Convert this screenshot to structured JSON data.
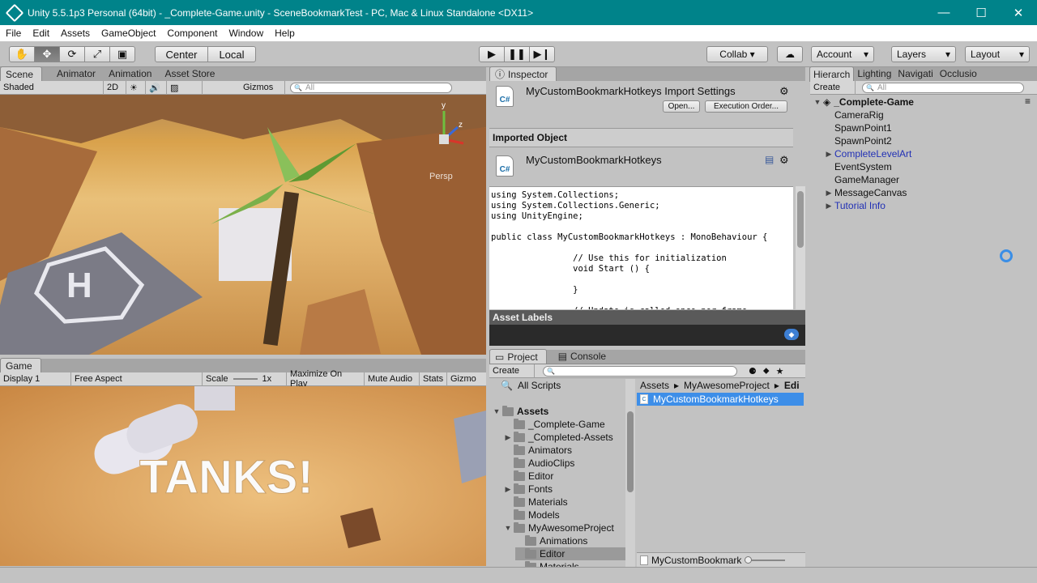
{
  "window": {
    "title": "Unity 5.5.1p3 Personal (64bit) - _Complete-Game.unity - SceneBookmarkTest - PC, Mac & Linux Standalone <DX11>",
    "controls": [
      "—",
      "☐",
      "✕"
    ]
  },
  "menu": [
    "File",
    "Edit",
    "Assets",
    "GameObject",
    "Component",
    "Window",
    "Help"
  ],
  "toolbar": {
    "transform_tools": [
      "hand-tool",
      "move-tool",
      "rotate-tool",
      "scale-tool",
      "rect-tool"
    ],
    "pivot_label": "Center",
    "space_label": "Local",
    "collab_label": "Collab ▾",
    "account_label": "Account",
    "layers_label": "Layers",
    "layout_label": "Layout"
  },
  "scene_panel": {
    "tabs": [
      "Scene",
      "Animator",
      "Animation",
      "Asset Store"
    ],
    "shading": "Shaded",
    "mode_2d": "2D",
    "gizmos": "Gizmos",
    "search_placeholder": "All",
    "persp_label": "Persp"
  },
  "game_panel": {
    "tab": "Game",
    "display": "Display 1",
    "aspect": "Free Aspect",
    "scale_label": "Scale",
    "scale_value": "1x",
    "maximize": "Maximize On Play",
    "mute": "Mute Audio",
    "stats": "Stats",
    "gizmos": "Gizmo",
    "logo_text": "TANKS!"
  },
  "inspector": {
    "tab": "Inspector",
    "header_title": "MyCustomBookmarkHotkeys Import Settings",
    "open_button": "Open...",
    "execution_order_button": "Execution Order...",
    "imported_object_heading": "Imported Object",
    "object_name": "MyCustomBookmarkHotkeys",
    "icon_text": "C#",
    "code": "using System.Collections;\nusing System.Collections.Generic;\nusing UnityEngine;\n\npublic class MyCustomBookmarkHotkeys : MonoBehaviour {\n\n\t\t// Use this for initialization\n\t\tvoid Start () {\n\n\t\t}\n\n\t\t// Update is called once per frame",
    "asset_labels_heading": "Asset Labels"
  },
  "project": {
    "tabs": [
      "Project",
      "Console"
    ],
    "create_label": "Create",
    "favorites": [
      "All Scripts"
    ],
    "tree": [
      {
        "label": "Assets",
        "depth": 0,
        "arrow": "▼",
        "bold": true
      },
      {
        "label": "_Complete-Game",
        "depth": 1,
        "arrow": ""
      },
      {
        "label": "_Completed-Assets",
        "depth": 1,
        "arrow": "▶"
      },
      {
        "label": "Animators",
        "depth": 1,
        "arrow": ""
      },
      {
        "label": "AudioClips",
        "depth": 1,
        "arrow": ""
      },
      {
        "label": "Editor",
        "depth": 1,
        "arrow": ""
      },
      {
        "label": "Fonts",
        "depth": 1,
        "arrow": "▶"
      },
      {
        "label": "Materials",
        "depth": 1,
        "arrow": ""
      },
      {
        "label": "Models",
        "depth": 1,
        "arrow": ""
      },
      {
        "label": "MyAwesomeProject",
        "depth": 1,
        "arrow": "▼"
      },
      {
        "label": "Animations",
        "depth": 2,
        "arrow": ""
      },
      {
        "label": "Editor",
        "depth": 2,
        "arrow": "",
        "selected": true
      },
      {
        "label": "Materials",
        "depth": 2,
        "arrow": ""
      }
    ],
    "breadcrumb": [
      "Assets",
      "MyAwesomeProject",
      "Edi"
    ],
    "selected_file": "MyCustomBookmarkHotkeys",
    "footer_file": "MyCustomBookmark"
  },
  "hierarchy": {
    "tabs": [
      "Hierarch",
      "Lighting",
      "Navigati",
      "Occlusio"
    ],
    "create_label": "Create",
    "search_placeholder": "All",
    "scene_name": "_Complete-Game",
    "items": [
      {
        "label": "CameraRig",
        "arrow": "",
        "prefab": false
      },
      {
        "label": "SpawnPoint1",
        "arrow": "",
        "prefab": false
      },
      {
        "label": "SpawnPoint2",
        "arrow": "",
        "prefab": false
      },
      {
        "label": "CompleteLevelArt",
        "arrow": "▶",
        "prefab": true
      },
      {
        "label": "EventSystem",
        "arrow": "",
        "prefab": false
      },
      {
        "label": "GameManager",
        "arrow": "",
        "prefab": false
      },
      {
        "label": "MessageCanvas",
        "arrow": "▶",
        "prefab": false
      },
      {
        "label": "Tutorial Info",
        "arrow": "▶",
        "prefab": true
      }
    ]
  },
  "colors": {
    "titlebar": "#00838a",
    "panel_bg": "#c2c2c2",
    "selection": "#3d8ee8",
    "prefab_text": "#2130b5"
  }
}
